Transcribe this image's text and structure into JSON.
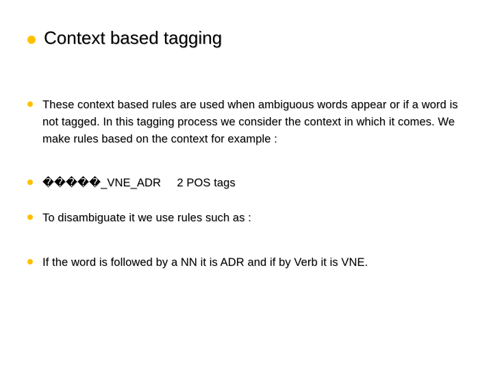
{
  "title": "Context based tagging",
  "bullets": [
    "These context based rules are used when ambiguous words appear or if a word is not tagged. In this tagging process we consider the context in which it comes. We make rules based on the context for example :",
    "�����_VNE_ADR     2 POS tags",
    "To disambiguate it we use rules such as :",
    "If the word is followed by a NN it is ADR and if by Verb it is VNE."
  ]
}
